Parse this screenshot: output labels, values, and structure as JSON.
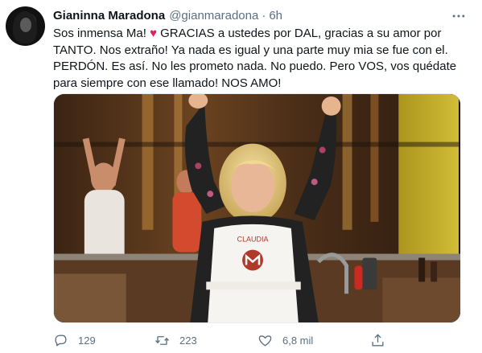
{
  "tweet": {
    "author_name": "Gianinna Maradona",
    "handle": "@gianmaradona",
    "separator": "·",
    "time": "6h",
    "text_before_heart": "Sos inmensa Ma! ",
    "heart": "♥",
    "text_after_heart": " GRACIAS a ustedes por DAL, gracias a su amor por TANTO. Nos extraño! Ya nada es igual y una parte muy mia se fue con el. PERDÓN. Es así. No les prometo nada. No puedo. Pero VOS, vos quédate para siempre con ese llamado! NOS AMO!",
    "image_apron_text": "CLAUDIA",
    "actions": {
      "reply_count": "129",
      "retweet_count": "223",
      "like_count": "6,8 mil"
    }
  },
  "icons": {
    "more": "more-horizontal-icon",
    "reply": "reply-icon",
    "retweet": "retweet-icon",
    "like": "heart-icon",
    "share": "share-icon"
  },
  "colors": {
    "text_primary": "#0f1419",
    "text_secondary": "#5b7083",
    "heart": "#e0245e"
  }
}
